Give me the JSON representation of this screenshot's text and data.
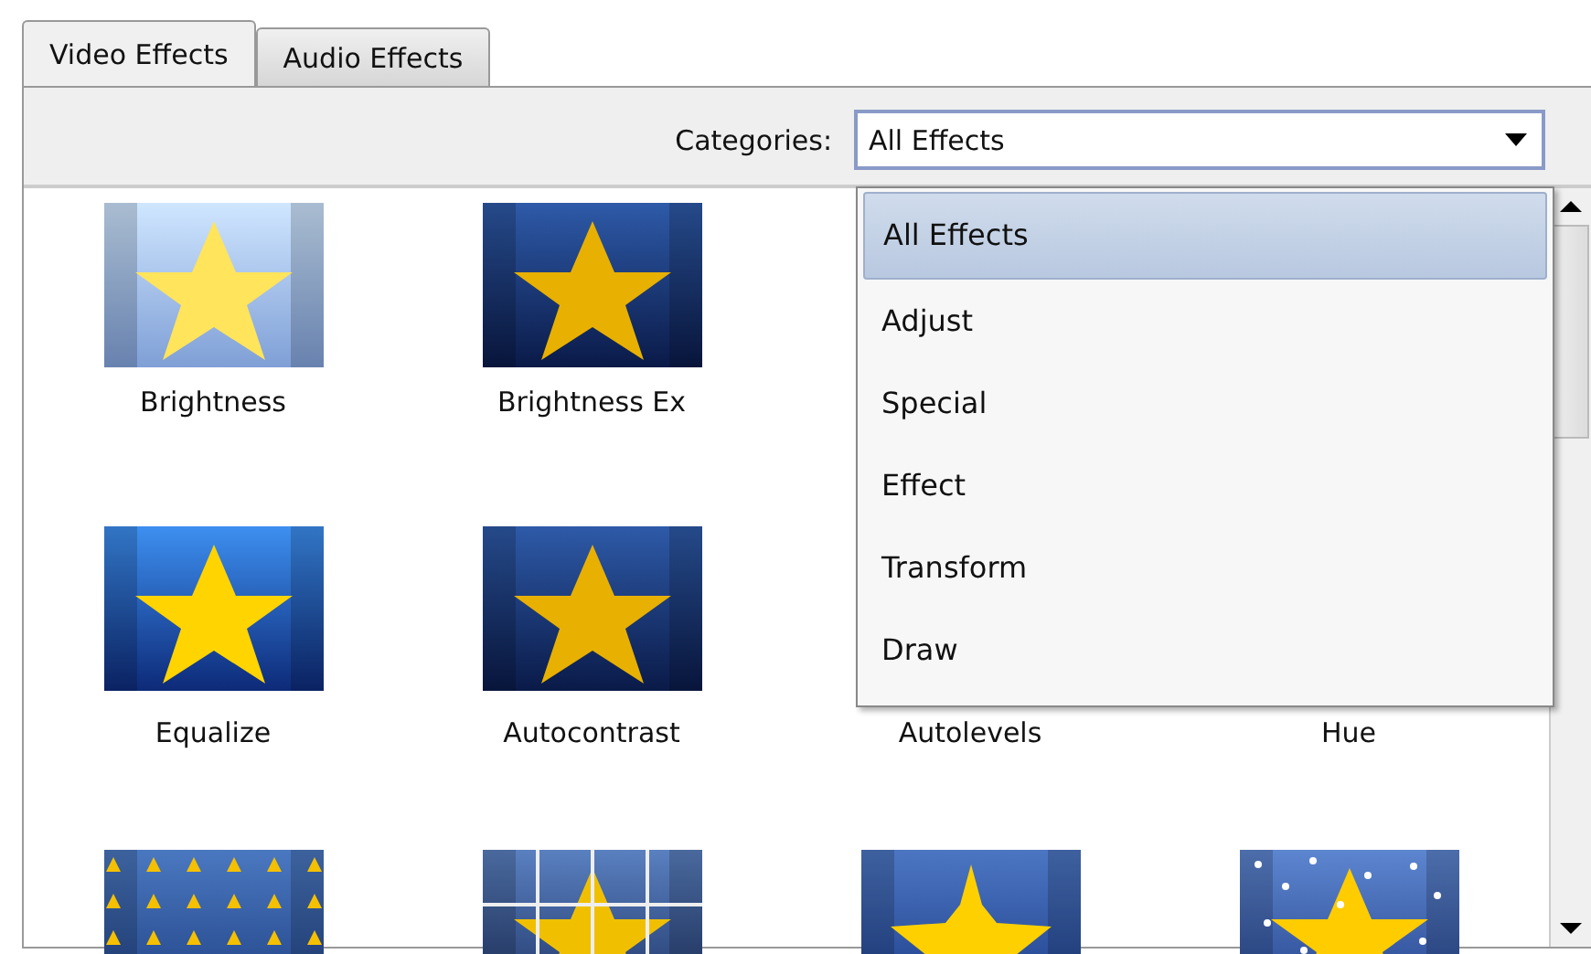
{
  "tabs": [
    {
      "label": "Video Effects",
      "selected": true
    },
    {
      "label": "Audio Effects",
      "selected": false
    }
  ],
  "categories": {
    "label": "Categories:",
    "value": "All Effects",
    "expanded": true,
    "options": [
      {
        "label": "All Effects",
        "selected": true
      },
      {
        "label": "Adjust",
        "selected": false
      },
      {
        "label": "Special",
        "selected": false
      },
      {
        "label": "Effect",
        "selected": false
      },
      {
        "label": "Transform",
        "selected": false
      },
      {
        "label": "Draw",
        "selected": false
      }
    ]
  },
  "effects": [
    [
      {
        "label": "Brightness",
        "kind": "light"
      },
      {
        "label": "Brightness Ex",
        "kind": "dark"
      }
    ],
    [
      {
        "label": "Equalize",
        "kind": "vivid"
      },
      {
        "label": "Autocontrast",
        "kind": "dark"
      },
      {
        "label": "Autolevels",
        "kind": "hidden"
      },
      {
        "label": "Hue",
        "kind": "hidden"
      }
    ],
    [
      {
        "kind": "mosaic"
      },
      {
        "kind": "puzzle"
      },
      {
        "kind": "jagged"
      },
      {
        "kind": "snow"
      }
    ]
  ]
}
